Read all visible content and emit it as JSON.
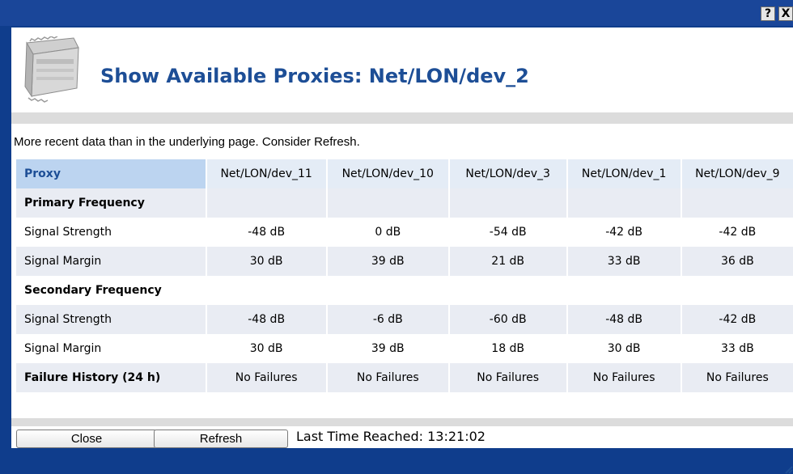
{
  "window": {
    "help_icon": "help-icon",
    "close_icon": "close-icon",
    "help_glyph": "?",
    "close_glyph": "X"
  },
  "header": {
    "title": "Show Available Proxies: Net/LON/dev_2",
    "icon": "device-module-icon"
  },
  "notice": "More recent data than in the underlying page. Consider Refresh.",
  "table": {
    "header_label": "Proxy",
    "columns": [
      "Net/LON/dev_11",
      "Net/LON/dev_10",
      "Net/LON/dev_3",
      "Net/LON/dev_1",
      "Net/LON/dev_9"
    ],
    "sections": [
      {
        "label": "Primary Frequency",
        "rows": [
          {
            "label": "Signal Strength",
            "values": [
              "-48 dB",
              "0 dB",
              "-54 dB",
              "-42 dB",
              "-42 dB"
            ]
          },
          {
            "label": "Signal Margin",
            "values": [
              "30 dB",
              "39 dB",
              "21 dB",
              "33 dB",
              "36 dB"
            ]
          }
        ]
      },
      {
        "label": "Secondary Frequency",
        "rows": [
          {
            "label": "Signal Strength",
            "values": [
              "-48 dB",
              "-6 dB",
              "-60 dB",
              "-48 dB",
              "-42 dB"
            ]
          },
          {
            "label": "Signal Margin",
            "values": [
              "30 dB",
              "39 dB",
              "18 dB",
              "30 dB",
              "33 dB"
            ]
          }
        ]
      }
    ],
    "failure": {
      "label": "Failure History (24 h)",
      "values": [
        "No Failures",
        "No Failures",
        "No Failures",
        "No Failures",
        "No Failures"
      ]
    }
  },
  "footer": {
    "close_label": "Close",
    "refresh_label": "Refresh",
    "last_time_reached": "Last Time Reached: 13:21:02"
  },
  "colors": {
    "window_frame": "#1a4699",
    "title_text": "#1d4e96",
    "table_header_label_bg": "#bcd4f0",
    "row_shade": "#e9ecf3",
    "divider": "#dcdcdc"
  }
}
